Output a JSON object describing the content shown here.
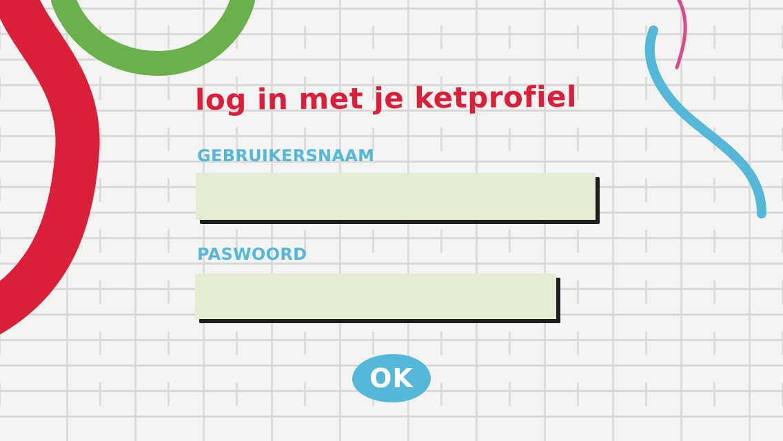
{
  "login": {
    "title": "log in met je ketprofiel",
    "username_label": "GEBRUIKERSNAAM",
    "username_value": "",
    "password_label": "PASWOORD",
    "password_value": "",
    "ok_label": "OK"
  },
  "colors": {
    "title": "#d91f3a",
    "label": "#55b8d8",
    "field_bg": "#e4ecd4",
    "field_shadow": "#1d1d1d",
    "button_bg": "#55b8d8",
    "graffiti_red": "#d91f3a",
    "graffiti_green": "#6ab04c",
    "graffiti_blue": "#55b8d8",
    "graffiti_pink": "#d84a8c"
  }
}
